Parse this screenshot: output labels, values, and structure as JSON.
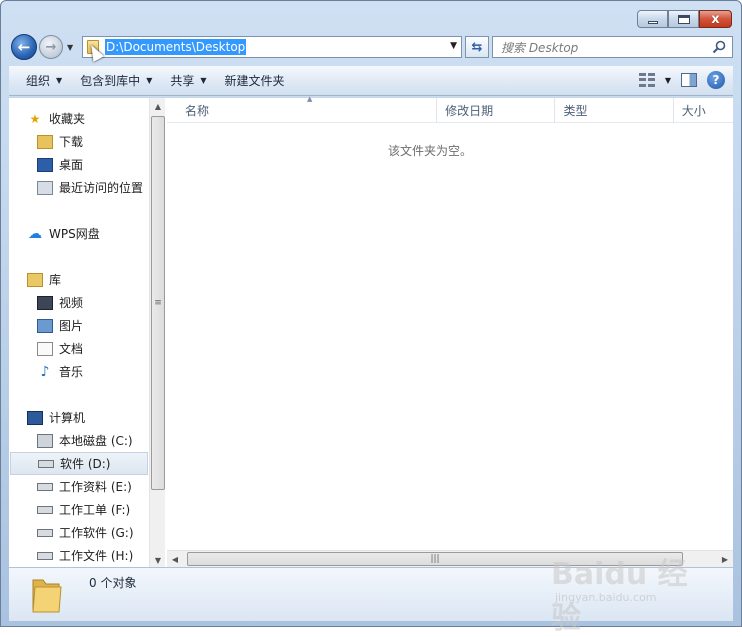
{
  "window": {
    "min_label": "",
    "max_label": "",
    "close_label": "x"
  },
  "address": {
    "path": "D:\\Documents\\Desktop"
  },
  "search": {
    "placeholder": "搜索 Desktop"
  },
  "toolbar": {
    "organize": "组织",
    "include_library": "包含到库中",
    "share": "共享",
    "new_folder": "新建文件夹"
  },
  "sidebar": {
    "favorites": "收藏夹",
    "downloads": "下载",
    "desktop": "桌面",
    "recent": "最近访问的位置",
    "wps": "WPS网盘",
    "libraries": "库",
    "videos": "视频",
    "pictures": "图片",
    "documents": "文档",
    "music": "音乐",
    "computer": "计算机",
    "drive_c": "本地磁盘 (C:)",
    "drive_d": "软件 (D:)",
    "drive_e": "工作资料 (E:)",
    "drive_f": "工作工单 (F:)",
    "drive_g": "工作软件 (G:)",
    "drive_h": "工作文件 (H:)"
  },
  "columns": {
    "name": "名称",
    "modified": "修改日期",
    "type": "类型",
    "size": "大小"
  },
  "content": {
    "empty_message": "该文件夹为空。"
  },
  "status": {
    "count": "0 个对象"
  },
  "watermark": {
    "brand": "Baidu 经验",
    "url": "jingyan.baidu.com"
  },
  "colors": {
    "selection": "#3399ff",
    "toolbar_text": "#1c2a3c",
    "column_text": "#4c607a"
  }
}
